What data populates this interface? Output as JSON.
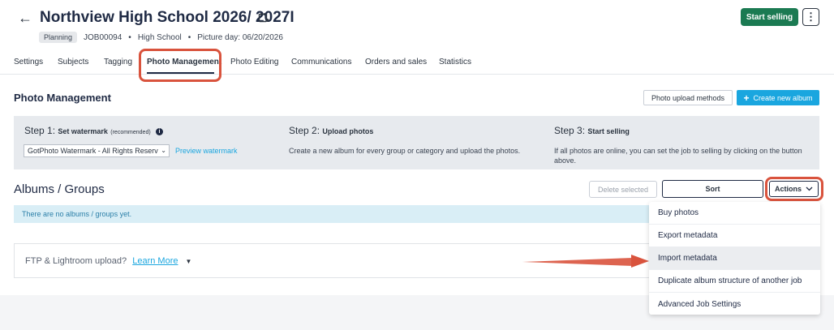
{
  "header": {
    "title": "Northview High School 2026/ 2027I",
    "badge": "Planning",
    "job_id": "JOB00094",
    "school_type": "High School",
    "picture_day": "Picture day: 06/20/2026",
    "start_selling": "Start selling",
    "more": "⋮"
  },
  "tabs": [
    {
      "label": "Settings"
    },
    {
      "label": "Subjects"
    },
    {
      "label": "Tagging"
    },
    {
      "label": "Photo Management"
    },
    {
      "label": "Photo Editing"
    },
    {
      "label": "Communications"
    },
    {
      "label": "Orders and sales"
    },
    {
      "label": "Statistics"
    }
  ],
  "active_tab": "Photo Management",
  "main": {
    "title": "Photo Management",
    "upload_methods": "Photo upload methods",
    "create_album": "Create new album",
    "create_album_icon": "+"
  },
  "steps": [
    {
      "label": "Step 1:",
      "title": "Set watermark",
      "note": "(recommended)",
      "select_value": "GotPhoto Watermark - All Rights Reserv",
      "preview": "Preview watermark"
    },
    {
      "label": "Step 2:",
      "title": "Upload photos",
      "text": "Create a new album for every group or category and upload the photos."
    },
    {
      "label": "Step 3:",
      "title": "Start selling",
      "text": "If all photos are online, you can set the job to selling by clicking on the button above."
    }
  ],
  "albums": {
    "title": "Albums / Groups",
    "delete_selected": "Delete selected",
    "sort": "Sort",
    "actions": "Actions",
    "empty_message": "There are no albums / groups yet."
  },
  "ftp": {
    "text": "FTP & Lightroom upload?",
    "link": "Learn More"
  },
  "actions_menu": [
    {
      "label": "Buy photos"
    },
    {
      "label": "Export metadata"
    },
    {
      "label": "Import metadata"
    },
    {
      "label": "Duplicate album structure of another job"
    },
    {
      "label": "Advanced Job Settings"
    }
  ],
  "colors": {
    "start_selling_bg": "#1b7a52",
    "create_album_bg": "#1aa6df",
    "annotation": "#d9533d"
  }
}
